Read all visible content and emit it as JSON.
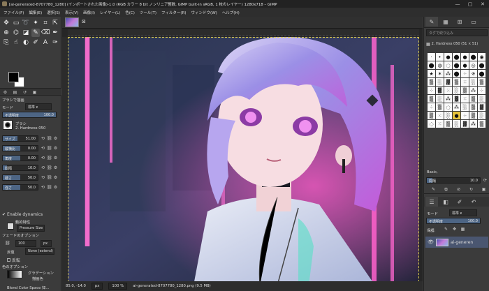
{
  "window": {
    "title": "[ai-generated-8707780_1280] (インポートされた画像)-1.0 (RGB カラー 8 bit ノンリニア整数, GIMP built-in sRGB, 1 枚のレイヤー) 1280x718 – GIMP"
  },
  "menu": [
    "ファイル(F)",
    "編集(E)",
    "選択(S)",
    "表示(V)",
    "画像(I)",
    "レイヤー(L)",
    "色(C)",
    "ツール(T)",
    "フィルター(R)",
    "ウィンドウ(W)",
    "ヘルプ(H)"
  ],
  "tool_options": {
    "section_title": "ブラシで描画",
    "mode_label": "モード",
    "mode_value": "標準",
    "opacity_label": "不透明度",
    "opacity_value": "100.0",
    "brush_label": "ブラシ",
    "brush_name": "2. Hardness 050",
    "rows": [
      {
        "label": "サイズ",
        "value": "51.00",
        "fill": 0.42
      },
      {
        "label": "縦横比",
        "value": "0.00",
        "fill": 0.5
      },
      {
        "label": "角度",
        "value": "0.00",
        "fill": 0.5
      },
      {
        "label": "間隔",
        "value": "10.0",
        "fill": 0.12
      },
      {
        "label": "硬さ",
        "value": "50.0",
        "fill": 0.5
      },
      {
        "label": "強さ",
        "value": "50.0",
        "fill": 0.5
      }
    ],
    "enable_dynamics": "Enable dynamics",
    "dynamics_label": "動的特性",
    "dynamics_value": "Pressure Size",
    "fade_label": "フェードのオプション",
    "fade_value": "100",
    "fade_unit": "px",
    "repeat_label": "反復",
    "repeat_value": "None (extend)",
    "reverse_label": "反転",
    "color_options_label": "色のオプション",
    "gradient_label": "グラデーション",
    "gradient_value": "描画色",
    "blend_label": "Blend Color Space 知..."
  },
  "status": {
    "coords": "85.0, -14.0",
    "unit": "px",
    "zoom": "100 %",
    "file": "ai-generated-8707780_1280.png (9.5 MB)"
  },
  "brushes_panel": {
    "filter_placeholder": "タグで絞り込み",
    "brush_title": "2. Hardness 050 (51 × 51)",
    "tag": "Basic,",
    "spacing_label": "間隔",
    "spacing_value": "10.0"
  },
  "layers_panel": {
    "mode_label": "モード",
    "mode_value": "標準",
    "opacity_label": "不透明度",
    "opacity_value": "100.0",
    "lock_label": "保護:",
    "layer_name": "ai-generen"
  },
  "colors": {
    "accent": "#4d6584",
    "background": "#3b3b3b",
    "canvas_bg": "#262626"
  }
}
